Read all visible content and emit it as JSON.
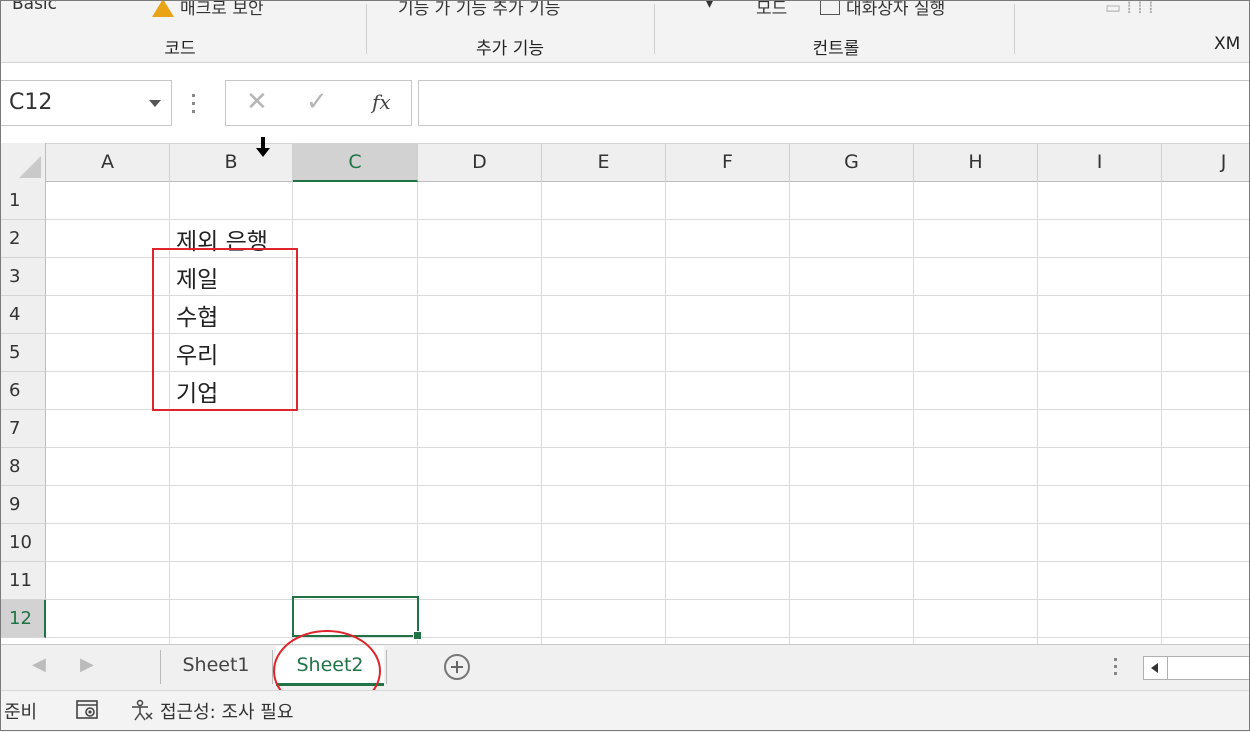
{
  "ribbon": {
    "top_labels": {
      "basic": "Basic",
      "macro_security": "매크로 보안",
      "addins": "기능   가 기능   추가 기능",
      "mode": "모드",
      "dialog": "대화상자 실행"
    },
    "groups": {
      "code": "코드",
      "addins": "추가 기능",
      "controls": "컨트롤",
      "xml": "XM"
    }
  },
  "formula_bar": {
    "name_box": "C12",
    "cancel_symbol": "✕",
    "enter_symbol": "✓",
    "fx_label": "fx",
    "formula": ""
  },
  "grid": {
    "columns": [
      "A",
      "B",
      "C",
      "D",
      "E",
      "F",
      "G",
      "H",
      "I",
      "J"
    ],
    "rows": [
      "1",
      "2",
      "3",
      "4",
      "5",
      "6",
      "7",
      "8",
      "9",
      "10",
      "11",
      "12"
    ],
    "selected_cell": "C12",
    "cells": {
      "B2": "제외 은행",
      "B3": "제일",
      "B4": "수협",
      "B5": "우리",
      "B6": "기업"
    }
  },
  "sheet_tabs": {
    "tabs": [
      "Sheet1",
      "Sheet2"
    ],
    "active": "Sheet2",
    "nav_prev": "◀",
    "nav_next": "▶"
  },
  "status_bar": {
    "ready": "준비",
    "accessibility": "접근성: 조사 필요"
  },
  "colors": {
    "accent": "#217346",
    "annotation": "#e0242b"
  }
}
